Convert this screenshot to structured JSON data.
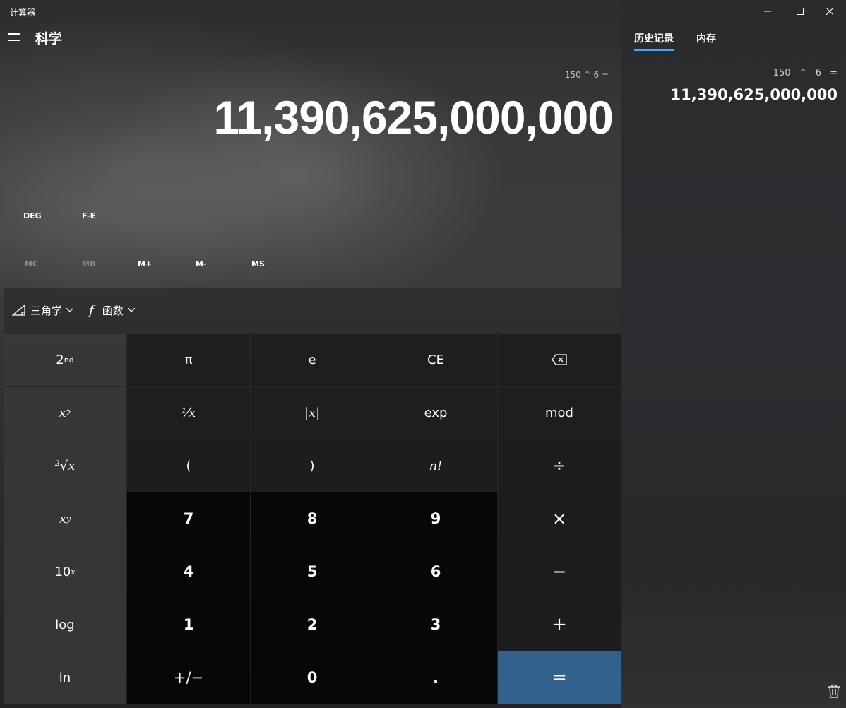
{
  "app": {
    "title": "计算器"
  },
  "header": {
    "mode": "科学"
  },
  "tabs": [
    {
      "label": "历史记录",
      "active": true
    },
    {
      "label": "内存",
      "active": false
    }
  ],
  "display": {
    "expression": "150 ^ 6 =",
    "result": "11,390,625,000,000"
  },
  "history": [
    {
      "expression": "150 ^ 6 =",
      "result": "11,390,625,000,000"
    }
  ],
  "mode_buttons": {
    "angle": "DEG",
    "fe": "F-E"
  },
  "memory": {
    "mc": "MC",
    "mr": "MR",
    "mplus": "M+",
    "mminus": "M-",
    "ms": "MS"
  },
  "functions": {
    "trig": "三角学",
    "func": "函数"
  },
  "keys": {
    "second": "2",
    "second_sup": "nd",
    "pi": "π",
    "e": "e",
    "ce": "CE",
    "x": "x",
    "two": "2",
    "y": "y",
    "reciprocal": "⅟x",
    "abs": "|x|",
    "exp": "exp",
    "mod": "mod",
    "sqrt": "²√x",
    "lparen": "(",
    "rparen": ")",
    "fact": "n!",
    "divide": "÷",
    "multiply": "×",
    "minus": "−",
    "plus": "+",
    "equals": "=",
    "ten": "10",
    "n7": "7",
    "n8": "8",
    "n9": "9",
    "n4": "4",
    "n5": "5",
    "n6": "6",
    "n1": "1",
    "n2": "2",
    "n3": "3",
    "log": "log",
    "ln": "ln",
    "negate": "+/−",
    "n0": "0",
    "decimal": "."
  },
  "colors": {
    "accent": "#4aa3ff",
    "equals_bg": "#31618c"
  }
}
